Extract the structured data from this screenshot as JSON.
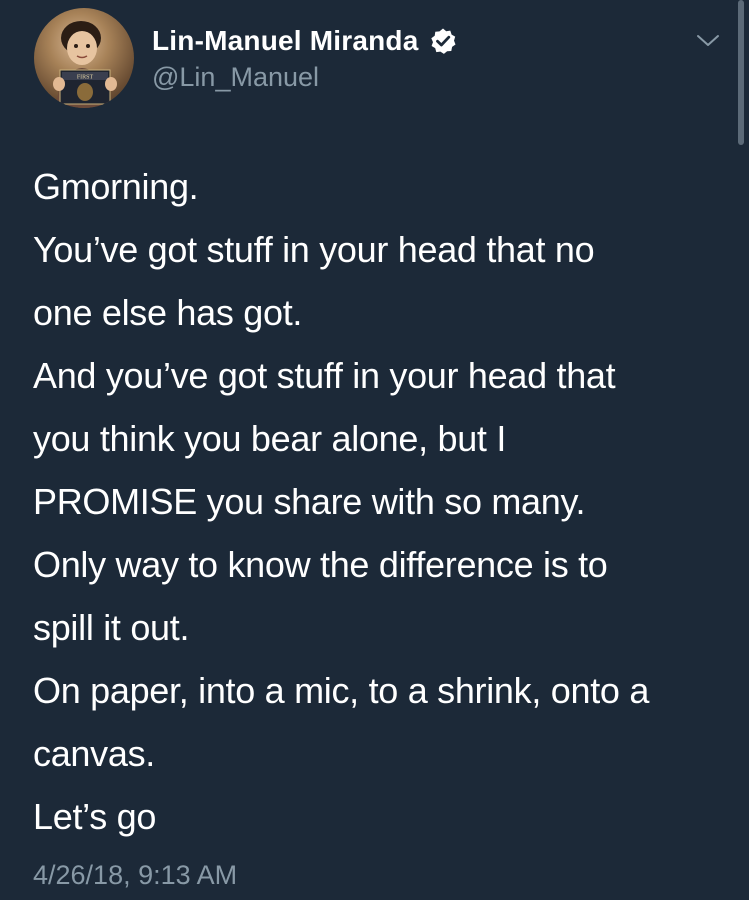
{
  "author": {
    "display_name": "Lin-Manuel Miranda",
    "handle": "@Lin_Manuel",
    "verified": true,
    "avatar_text": "FIRST"
  },
  "tweet": {
    "lines": [
      "Gmorning.",
      "You’ve got stuff in your head that no",
      "one else has got.",
      "And you’ve got stuff in your head that",
      "you think you bear alone, but I",
      "PROMISE you share with so many.",
      "Only way to know the difference is to",
      "spill it out.",
      "On paper, into a mic, to a shrink, onto a",
      "canvas.",
      "Let’s go"
    ],
    "timestamp": "4/26/18, 9:13 AM"
  },
  "icons": {
    "verified": "verified-badge-icon",
    "menu": "chevron-down-icon"
  },
  "colors": {
    "background": "#1c2938",
    "text": "#ffffff",
    "secondary_text": "#8899a6"
  }
}
